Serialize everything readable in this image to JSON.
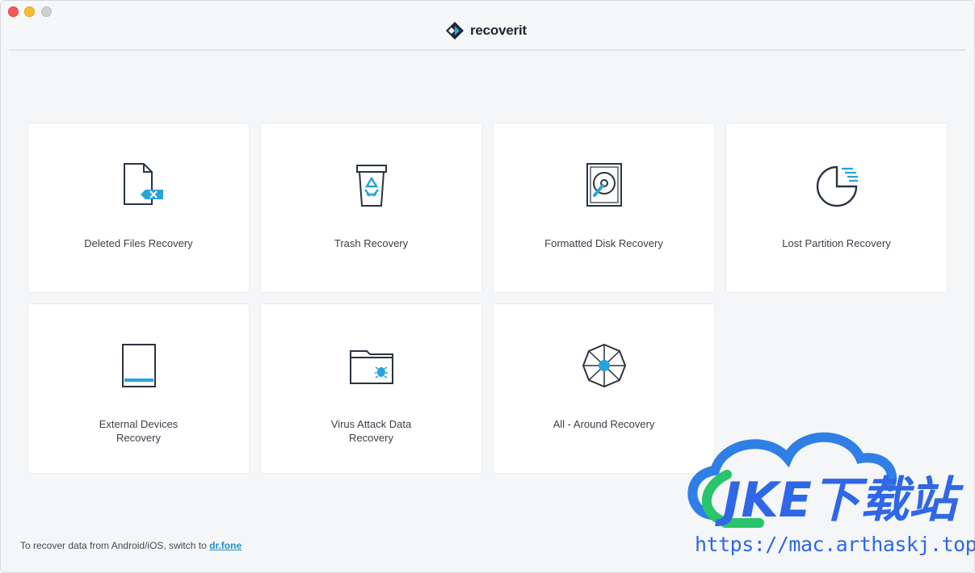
{
  "app": {
    "name": "recoverit"
  },
  "cards": [
    {
      "label": "Deleted Files Recovery",
      "icon": "deleted-file-icon"
    },
    {
      "label": "Trash Recovery",
      "icon": "trash-recycle-icon"
    },
    {
      "label": "Formatted Disk Recovery",
      "icon": "hard-disk-icon"
    },
    {
      "label": "Lost Partition Recovery",
      "icon": "partition-pie-icon"
    },
    {
      "label": "External Devices\nRecovery",
      "icon": "external-device-icon"
    },
    {
      "label": "Virus Attack Data\nRecovery",
      "icon": "virus-folder-icon"
    },
    {
      "label": "All - Around Recovery",
      "icon": "all-around-icon"
    }
  ],
  "footer": {
    "text": "To recover data from Android/iOS, switch to ",
    "link": "dr.fone"
  },
  "watermark": {
    "brand": "JKE下载站",
    "url": "https://mac.arthaskj.top"
  },
  "colors": {
    "accent": "#29a3dd",
    "link": "#1a8fd3",
    "icon_stroke": "#2b3440"
  }
}
